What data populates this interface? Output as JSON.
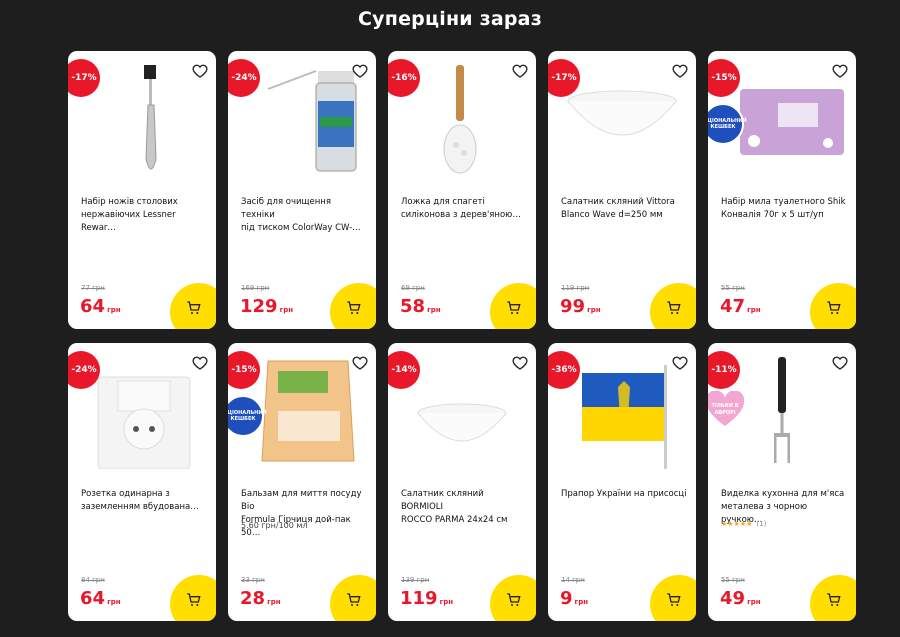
{
  "page": {
    "title": "Суперціни зараз"
  },
  "colors": {
    "background": "#1e1e1e",
    "discount": "#e8172a",
    "price": "#e8172a",
    "cart": "#ffde00"
  },
  "badges": {
    "national": "НАЦІОНАЛЬНИЙ КЕШБЕК",
    "app_only": "ТІЛЬКИ В АВРОРІ"
  },
  "currency": "грн",
  "products": [
    {
      "discount": "-17%",
      "name": "Набір ножів столових\nнержавіючих Lessner Rewar…",
      "old_price": "77 грн",
      "price": "64"
    },
    {
      "discount": "-24%",
      "name": "Засіб для очищення техніки\nпід тиском ColorWay CW-…",
      "old_price": "169 грн",
      "price": "129"
    },
    {
      "discount": "-16%",
      "name": "Ложка для спагеті\nсиліконова з дерев'яною…",
      "old_price": "69 грн",
      "price": "58"
    },
    {
      "discount": "-17%",
      "name": "Салатник скляний Vittora\nBlanco Wave d=250 мм",
      "old_price": "119 грн",
      "price": "99"
    },
    {
      "discount": "-15%",
      "name": "Набір мила туалетного Shik\nКонвалія 70г х 5 шт/уп",
      "old_price": "55 грн",
      "price": "47"
    },
    {
      "discount": "-24%",
      "name": "Розетка одинарна з\nзаземленням вбудована…",
      "old_price": "84 грн",
      "price": "64"
    },
    {
      "discount": "-15%",
      "name": "Бальзам для миття посуду Bio\nFormula Гірчиця дой-пак 50…",
      "unit_price": "5.60 грн/100 мл",
      "old_price": "33 грн",
      "price": "28"
    },
    {
      "discount": "-14%",
      "name": "Салатник скляний BORMIOLI\nROCCO PARMA 24x24 см",
      "old_price": "139 грн",
      "price": "119"
    },
    {
      "discount": "-36%",
      "name": "Прапор України на присосці",
      "old_price": "14 грн",
      "price": "9"
    },
    {
      "discount": "-11%",
      "name": "Виделка кухонна для м'яса\nметалева з чорною ручкою…",
      "rating": "★★★★★",
      "reviews": "(1)",
      "old_price": "55 грн",
      "price": "49"
    }
  ],
  "product_images": [
    "knife",
    "spray-can",
    "spaghetti-spoon",
    "salad-bowl",
    "soap-pack",
    "power-socket",
    "dish-liquid",
    "salad-bowl",
    "ukraine-flag",
    "meat-fork"
  ],
  "icons": {
    "heart": "heart-icon",
    "cart": "cart-icon"
  }
}
